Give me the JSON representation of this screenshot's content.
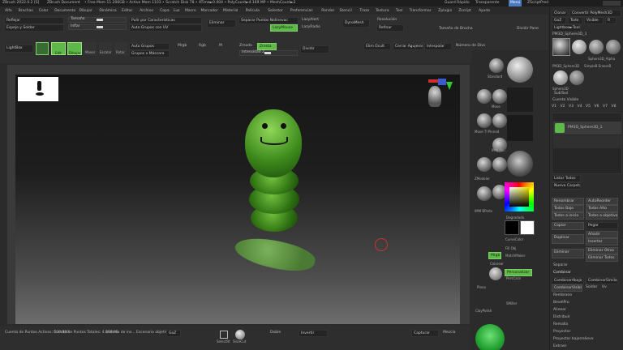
{
  "title_bar": {
    "app": "ZBrush 2022.0.2 [S]",
    "doc": "ZBrush Document",
    "stats": "• Free Mem 11.206GB • Active Mem 1103 • Scratch Disk 78 • ATime►0.004 • PolyCount►4.169 MP • MeshCount►2",
    "right_items": [
      "Guard Rápido",
      "Transparente",
      "Menú",
      "ZScriptPred"
    ]
  },
  "menu_bar": [
    "Alfa",
    "Brochas",
    "Color",
    "Documento",
    "Dibujar",
    "Dinámica",
    "Editar",
    "Archivo",
    "Capa",
    "Luz",
    "Macro",
    "Marcador",
    "Material",
    "Película",
    "Selector",
    "Preferencias",
    "Render",
    "Stencil",
    "Trazo",
    "Textura",
    "Tool",
    "Transformar",
    "Zplugin",
    "Zscript",
    "Ayuda"
  ],
  "top_shelf": {
    "row1": {
      "reflejar": "Reflejar",
      "tamano": "Tamaño",
      "pulir": "Pulir por Características",
      "eliminar": "Eliminar",
      "separar": "Separar Puntos Nolinevac",
      "lazy_alert": "LazyAlert",
      "dynamesh": "DynaMesh",
      "resolucion": "Resolución",
      "tamano_brocha": "Tamaño de Brocha",
      "dividir_pane": "Dividir Pane"
    },
    "row2": {
      "espejo": "Espejo y Soldar",
      "inflar": "Inflar",
      "auto_grupos_uv": "Auto Grupos con UV",
      "lazy_mouse": "LazyMouse",
      "lazy_radio": "LazyRadio",
      "refinar": "Refinar"
    },
    "row3": {
      "lightbox": "LightBox",
      "edit": "Edit",
      "dibujar": "Dibujar",
      "mover": "Mover",
      "escalar": "Escalar",
      "rotar": "Rotar",
      "auto_grupos": "Auto Grupos",
      "grupos_mascara": "Grupos x Máscara",
      "mrgb": "Mrgb",
      "rgb": "Rgb",
      "m": "M",
      "zmod": "Zmodo",
      "zresta": "Zresta",
      "z_intensity": "Intensidad Z",
      "dividir": "Dividir",
      "elim_ocult": "Elim Ocult",
      "cerrar_agujeros": "Cerrar Agujeros",
      "interpolar": "Interpolar",
      "numero_divs": "Número de Divs",
      "tomar": "Tomar directamente con modo"
    }
  },
  "right_tool_panel": {
    "buttons_top": [
      "Clonar",
      "Convertir PolyMesh3D",
      "GoZ",
      "Todo",
      "Visible",
      "R"
    ],
    "lightbox_tools": "Lightbox►Tools",
    "tool_name": "PM3D_Sphere3D_1",
    "thumbs": [
      "PM3D_Sphere3D",
      "Sphere3D_Alpha",
      "PM3D_Sphere3D",
      "SimpleB EraserB",
      "Sphere3D"
    ],
    "subtool": "SubTool",
    "cuenta_visible": "Cuenta Visible",
    "tabs": [
      "V1",
      "V2",
      "V3",
      "V4",
      "V5",
      "V6",
      "V7",
      "V8"
    ],
    "subtool_items": [
      "PM3D_Sphere3D_1"
    ],
    "lista_todos": "Listar Todos",
    "nueva_carpeta": "Nueva Carpeta",
    "renombrar": "Renombrar",
    "auto_reorder": "AutoReorder",
    "todos_bajo": "Todos Bajo",
    "todos_alto": "Todos Alto",
    "todos_inicio": "Todos a inicio",
    "todos_objetivo": "Todos a objetivo",
    "copiar": "Copiar",
    "pegar": "Pegar",
    "duplicar": "Duplicar",
    "anadir": "Añadir",
    "insertar": "Insertar",
    "eliminar": "Eliminar",
    "eliminar_otros": "Eliminar Otros",
    "eliminar_todos": "Eliminar Todos",
    "separar": "Separar",
    "combinar": "Combinar",
    "combinar_abajo": "CombinarAbajo",
    "combinar_similar": "CombinarSimilar",
    "combinar_visible": "CombinarVisible",
    "soldar": "Soldar",
    "uv": "Uv",
    "rembrano": "Rembrano",
    "bevel": "BevelPro",
    "alinear": "Alinear",
    "distribuir": "Distribuir",
    "remesher": "Remalla",
    "proyectar": "Proyectar",
    "proyectar_bajo": "Proyectar bajorrelieve",
    "extraer": "Extraer"
  },
  "left_palette": {
    "brushes": [
      "Standard",
      "ClayBuildup",
      "Move",
      "TrimDynamic",
      "hPolish",
      "Move Tl Pinned",
      "IMM Pri...",
      "ZModeler",
      "DamStandard",
      "ZRemesher Guides",
      "MaskPen",
      "IMM BParts",
      "ZBrushes"
    ],
    "alpha_label": "Degradado",
    "color_label": "CurveColor",
    "fill": "Fill Obj",
    "sicolorfill": "Colorear",
    "material": "ModelMat",
    "rgb_label": "MatchMaker",
    "personalizar": "Personalizar",
    "pers_rel": "PersCara",
    "plano": "Plano",
    "clay_polish": "ClayPolish",
    "smiller": "SMiller"
  },
  "mid_column": {
    "items": [
      "Standard",
      "Move",
      "Alpha",
      "Stroke",
      "Texture",
      "Material",
      "Dots"
    ]
  },
  "bottom_bar": {
    "cuenta_puntos": "Cuenta de Puntos Activos: 500.000",
    "cuenta_totales": "Cuenta de Puntos Totales: 4.169 Mi",
    "historia": "Historia de ins...",
    "escenario": "Escenario objetivo",
    "goz": "GoZ",
    "selectRl": "SelectRt",
    "slice": "SliceCut",
    "doble": "Doble",
    "invertir": "Invertir",
    "capturar": "Capturar",
    "mezcla": "Mezcla"
  },
  "colors": {
    "bg": "#2b2b2b",
    "panel": "#333333",
    "accent_green": "#5fb84a",
    "canvas_top": "#1a1a1a",
    "canvas_bottom": "#6b6b6b",
    "caterpillar": "#3f8f1f"
  }
}
